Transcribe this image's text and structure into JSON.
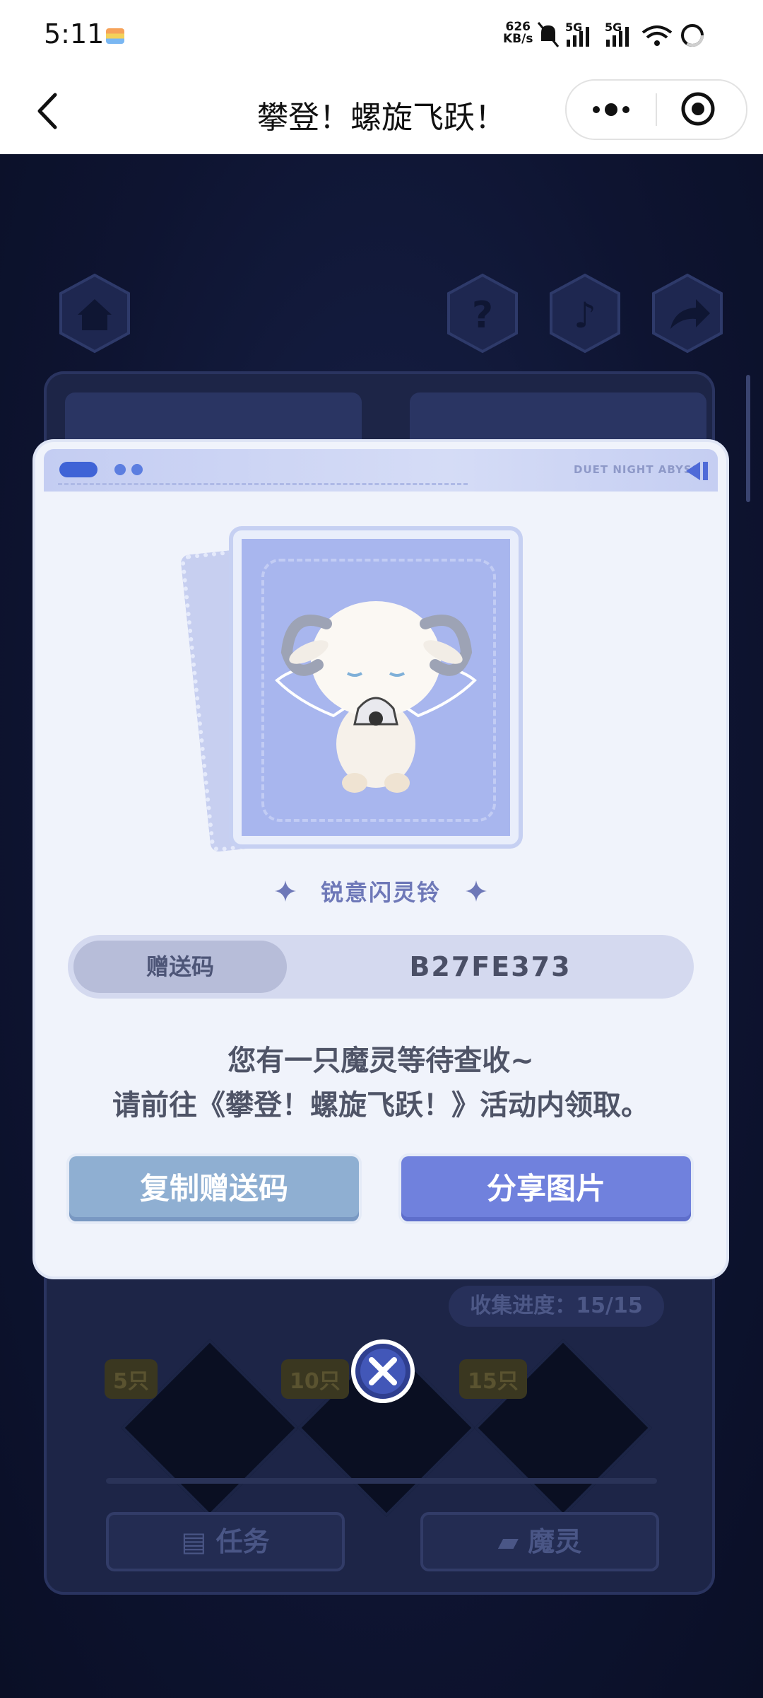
{
  "status_bar": {
    "time": "5:11",
    "net_speed_value": "626",
    "net_speed_unit": "KB/s",
    "sig1_label": "5G",
    "sig2_label": "5G"
  },
  "nav": {
    "title": "攀登！螺旋飞跃！"
  },
  "game_behind": {
    "progress_text": "收集进度：15/15",
    "milestones": [
      "5只",
      "10只",
      "15只"
    ],
    "tab_task": "任务",
    "tab_spirit": "魔灵"
  },
  "modal": {
    "header_tag": "DUET NIGHT ABYSS",
    "character_name": "锐意闪灵铃",
    "code_label": "赠送码",
    "code_value": "B27FE373",
    "message_line1": "您有一只魔灵等待查收~",
    "message_line2": "请前往《攀登！螺旋飞跃！》活动内领取。",
    "copy_button": "复制赠送码",
    "share_button": "分享图片"
  },
  "colors": {
    "accent": "#7081dd",
    "copy_button": "#8fafd2",
    "modal_bg": "#f0f3fb",
    "game_bg": "#0f1630"
  },
  "icons": {
    "home": "home-icon",
    "help": "question-icon",
    "music": "music-icon",
    "share": "share-icon",
    "close": "close-icon"
  }
}
